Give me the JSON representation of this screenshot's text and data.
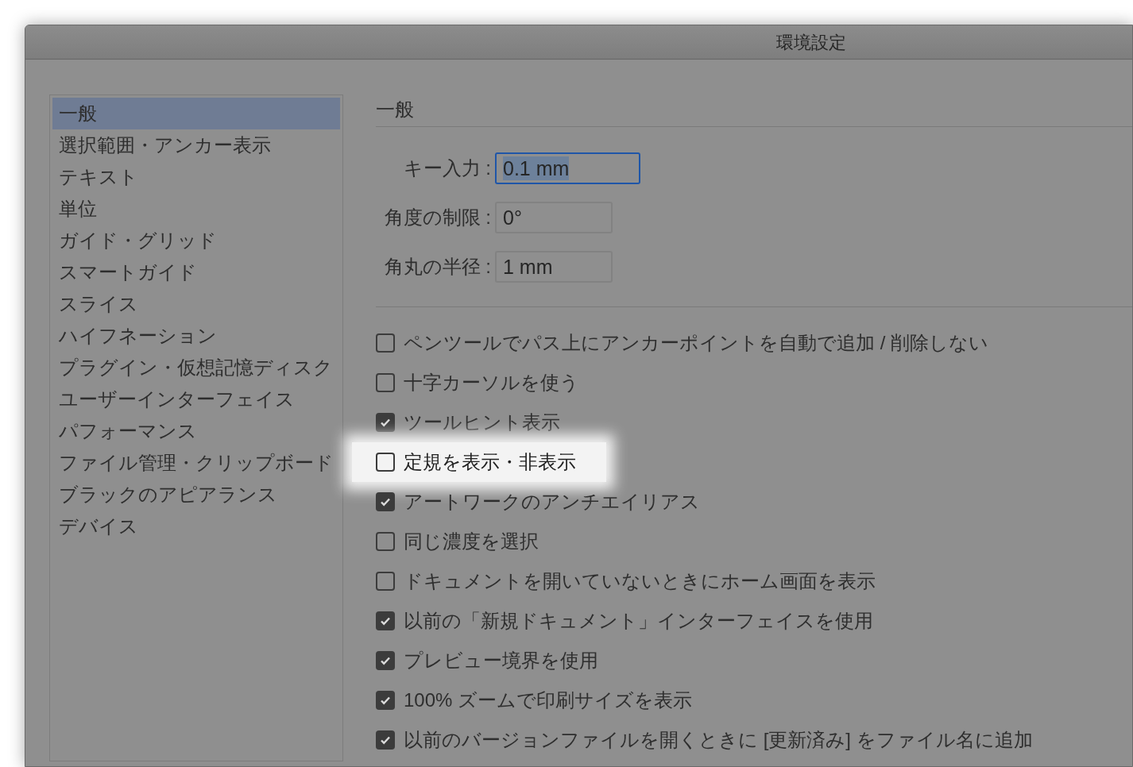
{
  "window": {
    "title": "環境設定"
  },
  "sidebar": {
    "items": [
      {
        "label": "一般",
        "selected": true
      },
      {
        "label": "選択範囲・アンカー表示",
        "selected": false
      },
      {
        "label": "テキスト",
        "selected": false
      },
      {
        "label": "単位",
        "selected": false
      },
      {
        "label": "ガイド・グリッド",
        "selected": false
      },
      {
        "label": "スマートガイド",
        "selected": false
      },
      {
        "label": "スライス",
        "selected": false
      },
      {
        "label": "ハイフネーション",
        "selected": false
      },
      {
        "label": "プラグイン・仮想記憶ディスク",
        "selected": false
      },
      {
        "label": "ユーザーインターフェイス",
        "selected": false
      },
      {
        "label": "パフォーマンス",
        "selected": false
      },
      {
        "label": "ファイル管理・クリップボード",
        "selected": false
      },
      {
        "label": "ブラックのアピアランス",
        "selected": false
      },
      {
        "label": "デバイス",
        "selected": false
      }
    ]
  },
  "section": {
    "title": "一般"
  },
  "fields": [
    {
      "label": "キー入力 :",
      "value": "0.1 mm",
      "focused": true
    },
    {
      "label": "角度の制限 :",
      "value": "0°",
      "focused": false
    },
    {
      "label": "角丸の半径 :",
      "value": "1 mm",
      "focused": false
    }
  ],
  "options": [
    {
      "label": "ペンツールでパス上にアンカーポイントを自動で追加 / 削除しない",
      "checked": false,
      "highlighted": false
    },
    {
      "label": "十字カーソルを使う",
      "checked": false,
      "highlighted": false
    },
    {
      "label": "ツールヒント表示",
      "checked": true,
      "highlighted": false
    },
    {
      "label": "定規を表示・非表示",
      "checked": false,
      "highlighted": true
    },
    {
      "label": "アートワークのアンチエイリアス",
      "checked": true,
      "highlighted": false
    },
    {
      "label": "同じ濃度を選択",
      "checked": false,
      "highlighted": false
    },
    {
      "label": "ドキュメントを開いていないときにホーム画面を表示",
      "checked": false,
      "highlighted": false
    },
    {
      "label": "以前の「新規ドキュメント」インターフェイスを使用",
      "checked": true,
      "highlighted": false
    },
    {
      "label": "プレビュー境界を使用",
      "checked": true,
      "highlighted": false
    },
    {
      "label": "100% ズームで印刷サイズを表示",
      "checked": true,
      "highlighted": false
    },
    {
      "label": "以前のバージョンファイルを開くときに [更新済み] をファイル名に追加",
      "checked": true,
      "highlighted": false
    }
  ]
}
